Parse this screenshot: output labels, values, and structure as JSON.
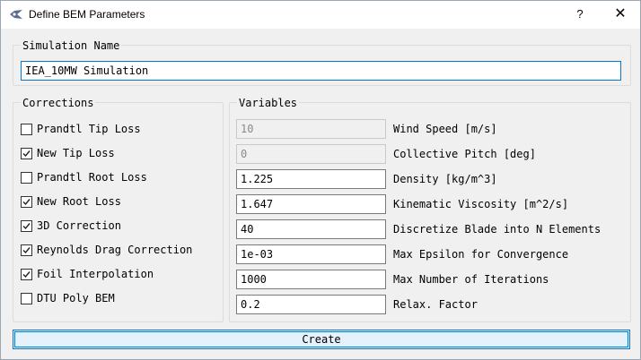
{
  "window": {
    "title": "Define BEM Parameters",
    "help_label": "?",
    "close_label": "✕"
  },
  "simulation": {
    "group_title": "Simulation Name",
    "name_value": "IEA_10MW Simulation"
  },
  "corrections": {
    "group_title": "Corrections",
    "items": [
      {
        "label": "Prandtl Tip Loss",
        "checked": false
      },
      {
        "label": "New Tip Loss",
        "checked": true
      },
      {
        "label": "Prandtl Root Loss",
        "checked": false
      },
      {
        "label": "New Root Loss",
        "checked": true
      },
      {
        "label": "3D Correction",
        "checked": true
      },
      {
        "label": "Reynolds Drag Correction",
        "checked": true
      },
      {
        "label": "Foil Interpolation",
        "checked": true
      },
      {
        "label": "DTU Poly BEM",
        "checked": false
      }
    ]
  },
  "variables": {
    "group_title": "Variables",
    "items": [
      {
        "value": "10",
        "label": "Wind Speed [m/s]",
        "disabled": true
      },
      {
        "value": "0",
        "label": "Collective Pitch [deg]",
        "disabled": true
      },
      {
        "value": "1.225",
        "label": "Density [kg/m^3]",
        "disabled": false
      },
      {
        "value": "1.647",
        "label": "Kinematic Viscosity [m^2/s]",
        "disabled": false
      },
      {
        "value": "40",
        "label": "Discretize Blade into N Elements",
        "disabled": false
      },
      {
        "value": "1e-03",
        "label": "Max Epsilon for Convergence",
        "disabled": false
      },
      {
        "value": "1000",
        "label": "Max Number of Iterations",
        "disabled": false
      },
      {
        "value": "0.2",
        "label": "Relax. Factor",
        "disabled": false
      }
    ]
  },
  "actions": {
    "create_label": "Create"
  },
  "colors": {
    "accent": "#0078d7",
    "window_bg": "#f0f0f0",
    "button_bg": "#e5f1fb"
  },
  "icons": {
    "app": "app-icon",
    "check": "check-icon",
    "close": "close-icon"
  }
}
